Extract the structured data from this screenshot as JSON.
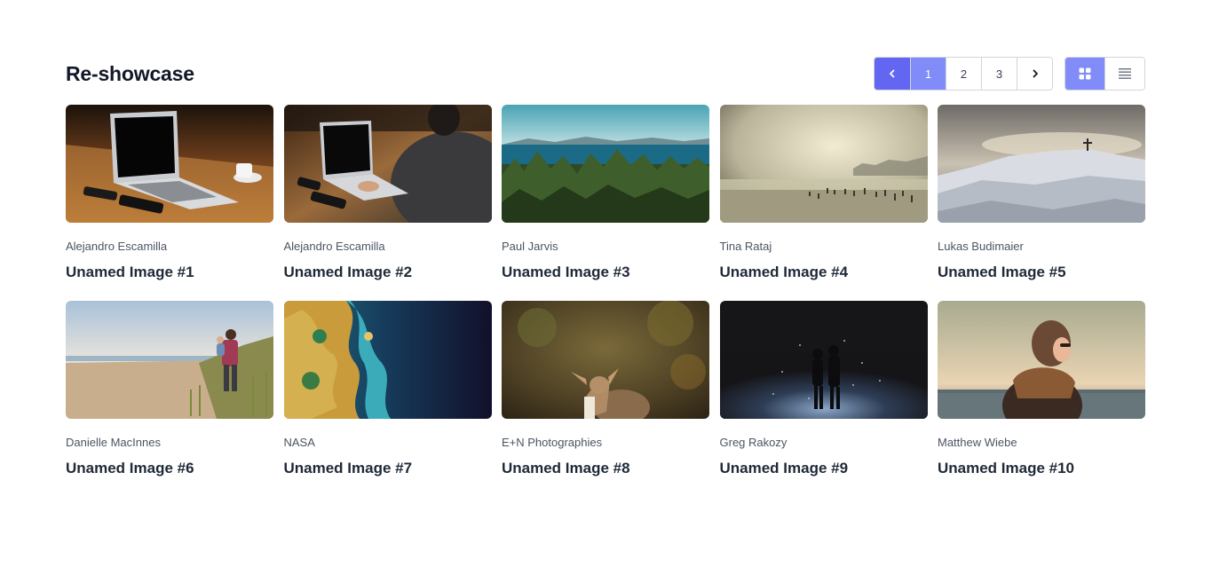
{
  "header": {
    "title": "Re-showcase"
  },
  "pagination": {
    "prev_icon": "chevron-left-icon",
    "next_icon": "chevron-right-icon",
    "pages": [
      "1",
      "2",
      "3"
    ],
    "current": "1"
  },
  "view_toggle": {
    "grid_icon": "grid-icon",
    "list_icon": "list-icon",
    "selected": "grid"
  },
  "colors": {
    "accent": "#6366f1",
    "accent_light": "#818cf8"
  },
  "images": [
    {
      "author": "Alejandro Escamilla",
      "name": "Unamed Image #1"
    },
    {
      "author": "Alejandro Escamilla",
      "name": "Unamed Image #2"
    },
    {
      "author": "Paul Jarvis",
      "name": "Unamed Image #3"
    },
    {
      "author": "Tina Rataj",
      "name": "Unamed Image #4"
    },
    {
      "author": "Lukas Budimaier",
      "name": "Unamed Image #5"
    },
    {
      "author": "Danielle MacInnes",
      "name": "Unamed Image #6"
    },
    {
      "author": "NASA",
      "name": "Unamed Image #7"
    },
    {
      "author": "E+N Photographies",
      "name": "Unamed Image #8"
    },
    {
      "author": "Greg Rakozy",
      "name": "Unamed Image #9"
    },
    {
      "author": "Matthew Wiebe",
      "name": "Unamed Image #10"
    }
  ]
}
